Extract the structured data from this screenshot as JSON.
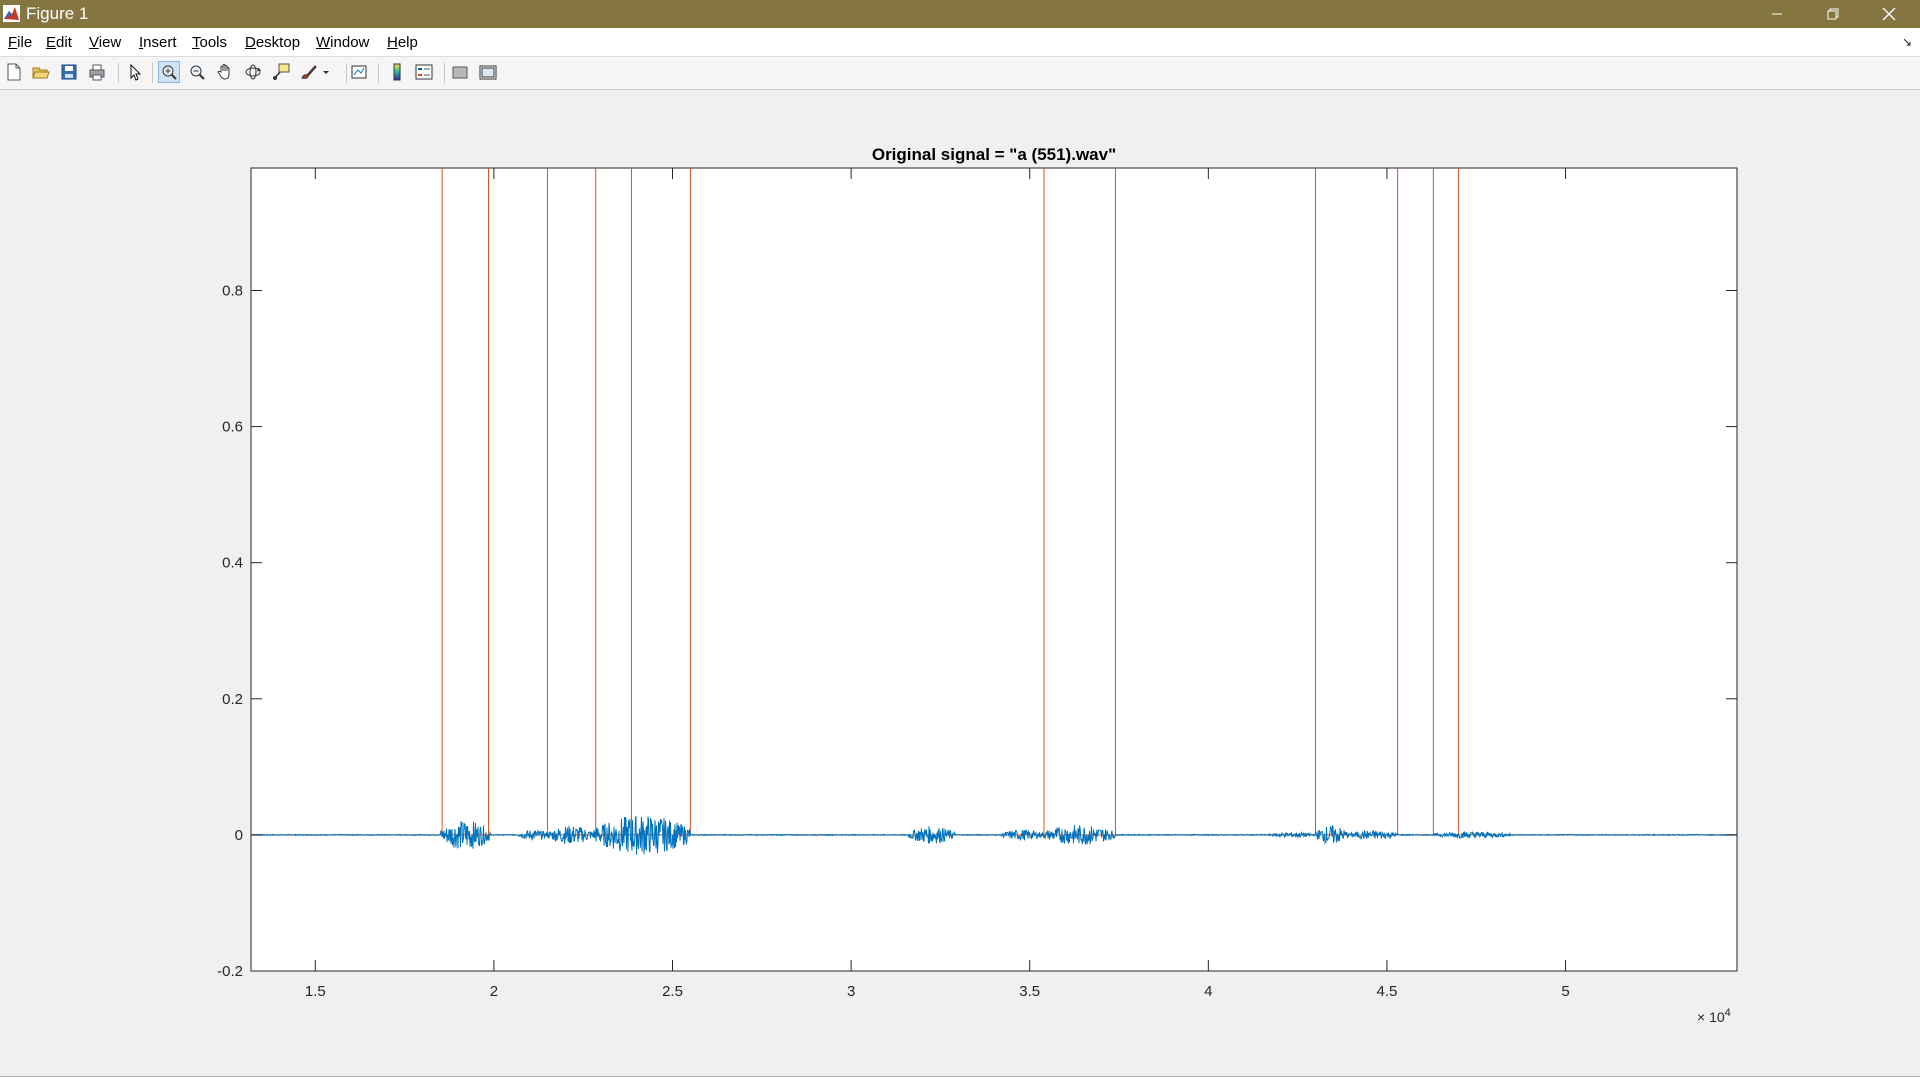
{
  "window": {
    "title": "Figure 1",
    "titlebar_color": "#857540"
  },
  "menu": {
    "items": [
      {
        "accel": "F",
        "rest": "ile"
      },
      {
        "accel": "E",
        "rest": "dit"
      },
      {
        "accel": "V",
        "rest": "iew"
      },
      {
        "accel": "I",
        "rest": "nsert"
      },
      {
        "accel": "T",
        "rest": "ools"
      },
      {
        "accel": "D",
        "rest": "esktop"
      },
      {
        "accel": "W",
        "rest": "indow"
      },
      {
        "accel": "H",
        "rest": "elp"
      }
    ]
  },
  "toolbar": {
    "icons": [
      "new-figure-icon",
      "open-file-icon",
      "save-icon",
      "print-icon",
      "edit-plot-arrow-icon",
      "zoom-in-icon",
      "zoom-out-icon",
      "pan-hand-icon",
      "rotate-3d-icon",
      "data-cursor-icon",
      "brush-icon",
      "link-plot-icon",
      "insert-colorbar-icon",
      "insert-legend-icon",
      "hide-plot-tools-icon",
      "show-plot-tools-icon"
    ],
    "active_tool": "zoom-in-icon"
  },
  "chart_data": {
    "type": "line",
    "title": "Original signal = \"a (551).wav\"",
    "xlabel": "",
    "ylabel": "",
    "xlim": [
      13200,
      54800
    ],
    "ylim": [
      -0.2,
      0.98
    ],
    "xticks": [
      15000,
      20000,
      25000,
      30000,
      35000,
      40000,
      45000,
      50000
    ],
    "xtick_labels": [
      "1.5",
      "2",
      "2.5",
      "3",
      "3.5",
      "4",
      "4.5",
      "5"
    ],
    "x_exponent_label": "× 10",
    "x_exponent_power": "4",
    "yticks": [
      -0.2,
      0,
      0.2,
      0.4,
      0.6,
      0.8
    ],
    "ytick_labels": [
      "-0.2",
      "0",
      "0.2",
      "0.4",
      "0.6",
      "0.8"
    ],
    "grid": false,
    "signal_color": "#0072bd",
    "marker_color": "#d95319",
    "segment_markers_x": [
      18550,
      19850,
      21500,
      22850,
      23850,
      25500,
      35400,
      37400,
      43000,
      45300,
      46300,
      47000
    ],
    "signal_bursts": [
      {
        "x_start": 18500,
        "x_end": 19900,
        "amplitude": 0.022
      },
      {
        "x_start": 20700,
        "x_end": 21500,
        "amplitude": 0.008
      },
      {
        "x_start": 21500,
        "x_end": 22800,
        "amplitude": 0.014
      },
      {
        "x_start": 22800,
        "x_end": 25500,
        "amplitude": 0.03
      },
      {
        "x_start": 31600,
        "x_end": 32900,
        "amplitude": 0.013
      },
      {
        "x_start": 34200,
        "x_end": 35400,
        "amplitude": 0.008
      },
      {
        "x_start": 35400,
        "x_end": 37400,
        "amplitude": 0.015
      },
      {
        "x_start": 41700,
        "x_end": 43000,
        "amplitude": 0.004
      },
      {
        "x_start": 43000,
        "x_end": 43900,
        "amplitude": 0.014
      },
      {
        "x_start": 43900,
        "x_end": 45300,
        "amplitude": 0.007
      },
      {
        "x_start": 46300,
        "x_end": 48500,
        "amplitude": 0.005
      }
    ]
  }
}
